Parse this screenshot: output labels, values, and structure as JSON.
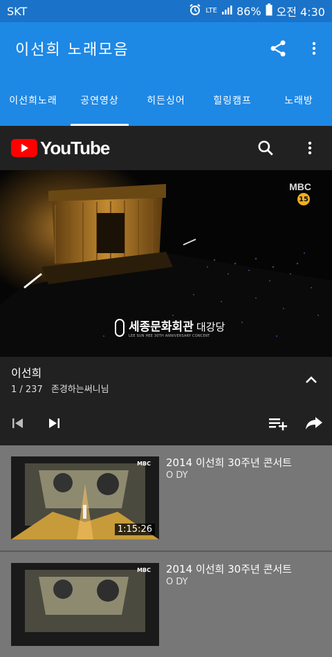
{
  "status": {
    "carrier": "SKT",
    "network": "LTE",
    "battery": "86%",
    "time": "오전 4:30"
  },
  "appbar": {
    "title": "이선희 노래모음",
    "share_icon": "share-icon",
    "menu_icon": "more-vert-icon"
  },
  "tabs": [
    {
      "label": "이선희노래",
      "active": false
    },
    {
      "label": "공연영상",
      "active": true
    },
    {
      "label": "히든싱어",
      "active": false
    },
    {
      "label": "힐링캠프",
      "active": false
    },
    {
      "label": "노래방",
      "active": false
    }
  ],
  "youtube": {
    "logo_text": "YouTube",
    "brand_color": "#ff0000"
  },
  "player": {
    "channel_logo": "MBC",
    "rating": "15",
    "venue_caption": "세종문화회관",
    "venue_hall": "대강당",
    "concert_caption": "LEE SUN HEE 30TH ANNIVERSARY CONCERT"
  },
  "now_playing": {
    "title": "이선희",
    "position": "1 / 237",
    "subtitle": "존경하는써니님"
  },
  "playlist": [
    {
      "title": "2014 이선희 30주년 콘서트",
      "channel": "O DY",
      "duration": "1:15:26",
      "thumb_logo": "MBC"
    },
    {
      "title": "2014 이선희 30주년 콘서트",
      "channel": "O DY",
      "thumb_logo": "MBC"
    }
  ]
}
